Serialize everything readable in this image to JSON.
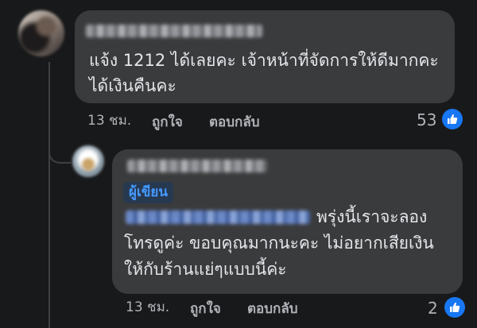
{
  "comments": [
    {
      "text_line1": "แจ้ง 1212 ได้เลยคะ เจ้าหน้าที่จัดการให้ดีมากคะ",
      "text_line2": "ได้เงินคืนคะ",
      "time": "13 ชม.",
      "like_label": "ถูกใจ",
      "reply_label": "ตอบกลับ",
      "reaction_count": "53",
      "reaction_icon": "like-icon"
    }
  ],
  "reply": {
    "author_badge": "ผู้เขียน",
    "text_line1": "พรุ่งนี้เราจะลอง",
    "text_line2": "โทรดูค่ะ  ขอบคุณมากนะคะ ไม่อยากเสียเงิน",
    "text_line3": "ให้กับร้านแย่ๆแบบนี้ค่ะ",
    "time": "13 ชม.",
    "like_label": "ถูกใจ",
    "reply_label": "ตอบกลับ",
    "reaction_count": "2",
    "reaction_icon": "like-icon"
  },
  "colors": {
    "background": "#18191a",
    "bubble": "#3a3b3c",
    "text": "#e4e6eb",
    "meta_text": "#b0b3b8",
    "like_blue": "#1877f2",
    "author_badge_bg": "#263951",
    "author_badge_text": "#4599ff"
  }
}
